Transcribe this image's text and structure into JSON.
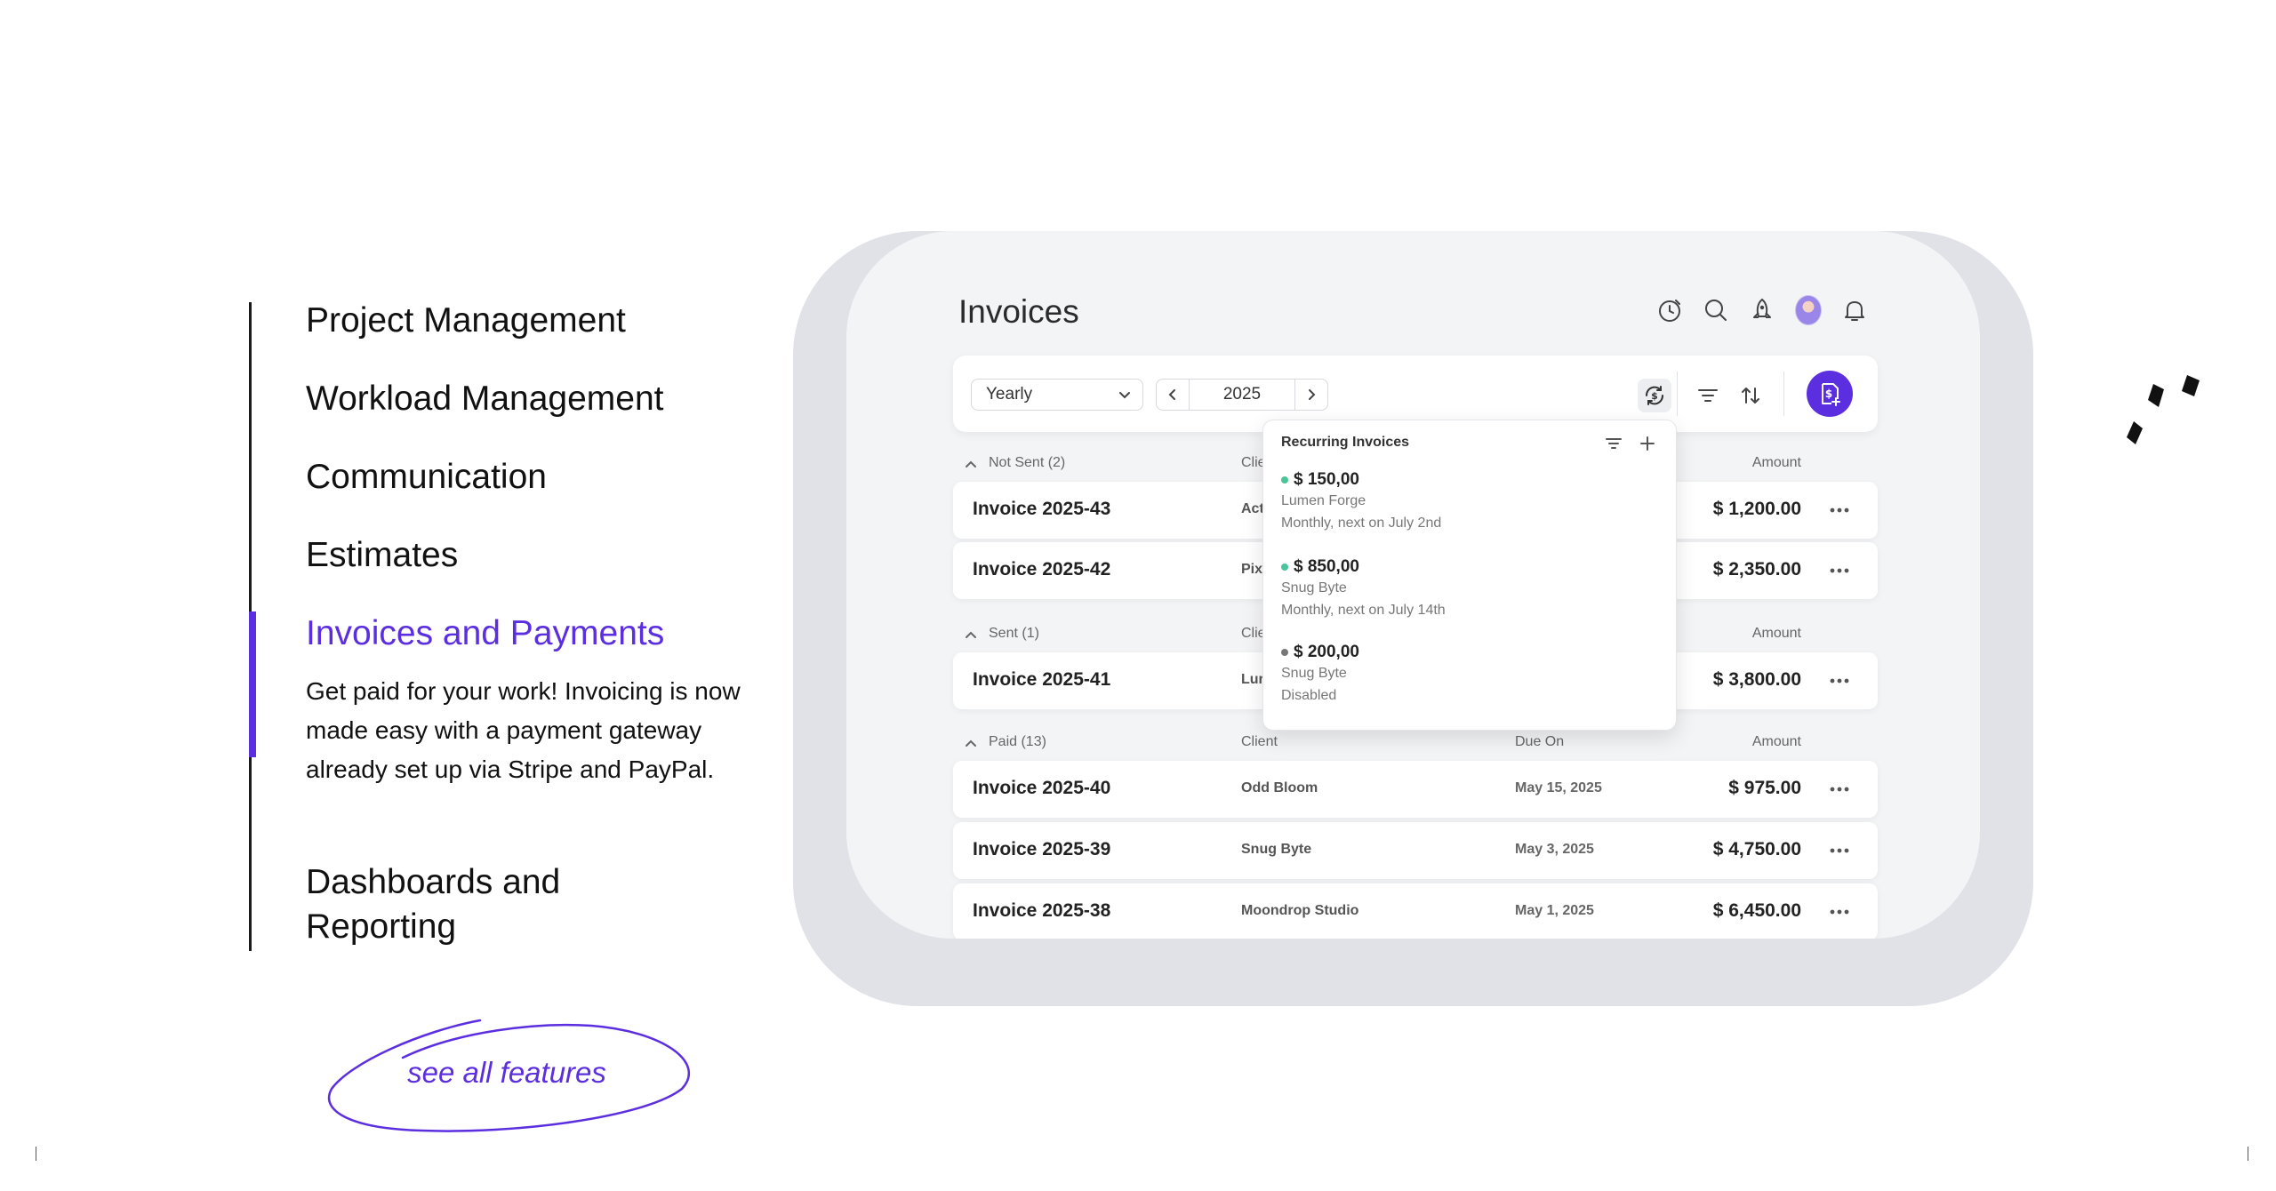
{
  "features": {
    "items": [
      {
        "label": "Project Management"
      },
      {
        "label": "Workload Management"
      },
      {
        "label": "Communication"
      },
      {
        "label": "Estimates"
      },
      {
        "label": "Invoices and Payments"
      },
      {
        "label": "Dashboards and Reporting"
      }
    ],
    "active_index": 4,
    "active_description": "Get paid for your work! Invoicing is now made easy with a payment gateway already set up via Stripe and PayPal.",
    "see_all_label": "see all features"
  },
  "app": {
    "title": "Invoices",
    "header_icons": [
      "timer-icon",
      "search-icon",
      "rocket-icon",
      "avatar",
      "bell-icon"
    ],
    "toolbar": {
      "period_select": "Yearly",
      "year": "2025"
    },
    "groups": [
      {
        "title": "Not Sent (2)",
        "columns": {
          "client": "Clie",
          "due": "",
          "amount": "Amount"
        },
        "rows": [
          {
            "number": "Invoice 2025-43",
            "client": "Act",
            "due": "",
            "amount": "$ 1,200.00"
          },
          {
            "number": "Invoice 2025-42",
            "client": "Pix",
            "due": "",
            "amount": "$ 2,350.00"
          }
        ]
      },
      {
        "title": "Sent (1)",
        "columns": {
          "client": "Clie",
          "due": "",
          "amount": "Amount"
        },
        "rows": [
          {
            "number": "Invoice 2025-41",
            "client": "Lur",
            "due": "",
            "amount": "$ 3,800.00"
          }
        ]
      },
      {
        "title": "Paid (13)",
        "columns": {
          "client": "Client",
          "due": "Due On",
          "amount": "Amount"
        },
        "rows": [
          {
            "number": "Invoice 2025-40",
            "client": "Odd Bloom",
            "due": "May 15, 2025",
            "amount": "$ 975.00"
          },
          {
            "number": "Invoice 2025-39",
            "client": "Snug Byte",
            "due": "May 3, 2025",
            "amount": "$ 4,750.00"
          },
          {
            "number": "Invoice 2025-38",
            "client": "Moondrop Studio",
            "due": "May 1, 2025",
            "amount": "$ 6,450.00"
          }
        ]
      }
    ],
    "recurring_popover": {
      "title": "Recurring Invoices",
      "items": [
        {
          "amount": "$ 150,00",
          "client": "Lumen Forge",
          "schedule": "Monthly, next on July 2nd",
          "status_color": "#4cc49a"
        },
        {
          "amount": "$ 850,00",
          "client": "Snug Byte",
          "schedule": "Monthly, next on July 14th",
          "status_color": "#4cc49a"
        },
        {
          "amount": "$ 200,00",
          "client": "Snug Byte",
          "schedule": "Disabled",
          "status_color": "#777777"
        }
      ]
    }
  },
  "colors": {
    "accent": "#5b2ee0",
    "active_dot": "#4cc49a",
    "disabled_dot": "#777777"
  }
}
